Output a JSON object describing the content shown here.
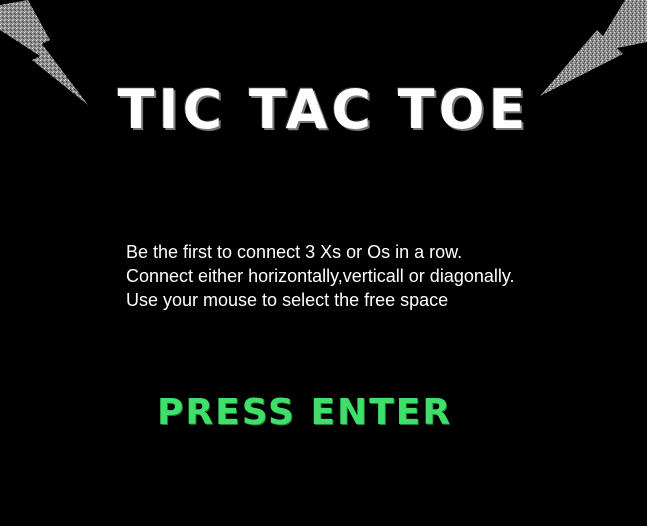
{
  "game": {
    "title": "TIC TAC TOE",
    "instructions": [
      "Be the first to connect 3 Xs or Os in a row.",
      "Connect either horizontally,verticall or diagonally.",
      "Use your mouse to select the free space"
    ],
    "prompt": "PRESS ENTER"
  },
  "colors": {
    "background": "#000000",
    "title": "#ffffff",
    "text": "#ffffff",
    "prompt": "#3fe06a",
    "bolt": "#9a9a9a"
  }
}
